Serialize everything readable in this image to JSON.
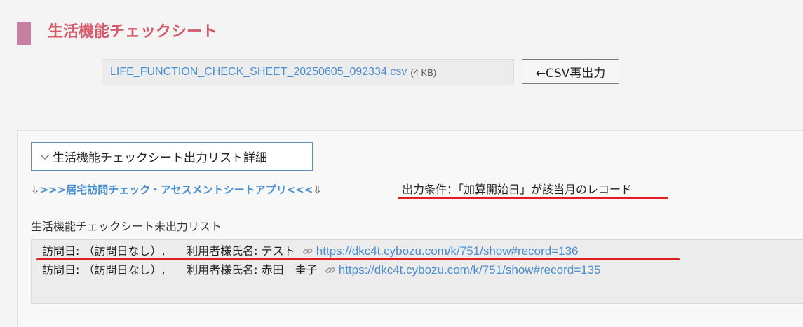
{
  "page": {
    "title": "生活機能チェックシート"
  },
  "file": {
    "name": "LIFE_FUNCTION_CHECK_SHEET_20250605_092334.csv",
    "size": "(4 KB)"
  },
  "toolbar": {
    "csv_button": "←CSV再出力"
  },
  "details": {
    "label": "生活機能チェックシート出力リスト詳細"
  },
  "app_link": {
    "left_arrow": "⇩",
    "text": ">>>居宅訪問チェック・アセスメントシートアプリ<<<",
    "right_arrow": "⇩"
  },
  "condition": "出力条件：「加算開始日」が該当月のレコード",
  "list": {
    "label": "生活機能チェックシート未出力リスト",
    "rows": [
      {
        "visit": "訪問日: （訪問日なし）,",
        "user": "利用者様氏名: テスト",
        "url": "https://dkc4t.cybozu.com/k/751/show#record=136"
      },
      {
        "visit": "訪問日: （訪問日なし）,",
        "user": "利用者様氏名: 赤田　圭子",
        "url": "https://dkc4t.cybozu.com/k/751/show#record=135"
      }
    ]
  },
  "colors": {
    "title": "#d45a6a",
    "title_bar": "#c77fa4",
    "link": "#4a8fd0",
    "underline": "#e02020"
  }
}
